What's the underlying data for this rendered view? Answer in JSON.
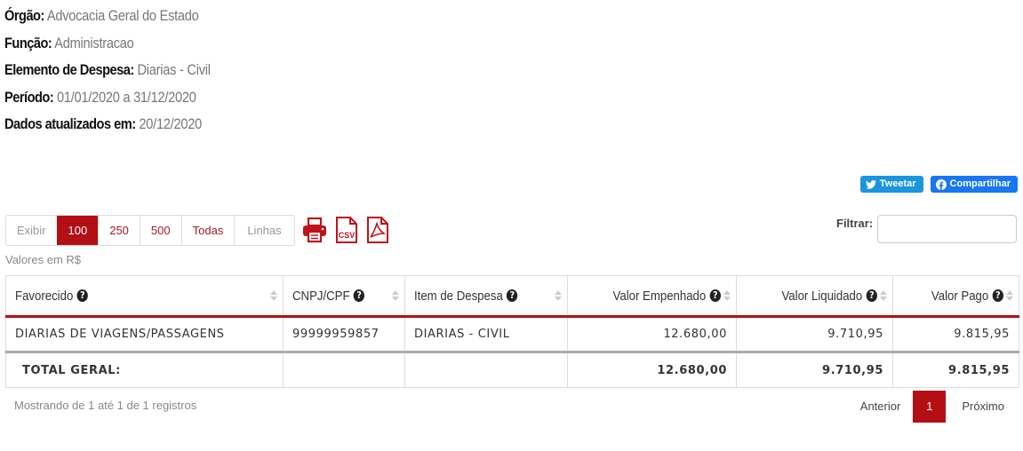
{
  "meta": [
    {
      "label": "Órgão:",
      "value": "Advocacia Geral do Estado"
    },
    {
      "label": "Função:",
      "value": "Administracao"
    },
    {
      "label": "Elemento de Despesa:",
      "value": "Diarias - Civil"
    },
    {
      "label": "Período:",
      "value": "01/01/2020 a 31/12/2020"
    },
    {
      "label": "Dados atualizados em:",
      "value": "20/12/2020"
    }
  ],
  "social": {
    "tweet": "Tweetar",
    "share": "Compartilhar",
    "tweet_color": "#1b95e0",
    "share_color": "#1877f2"
  },
  "page_size": {
    "show_label": "Exibir",
    "options": [
      "100",
      "250",
      "500",
      "Todas"
    ],
    "selected": "100",
    "suffix": "Linhas"
  },
  "exports": {
    "print_icon": "print-icon",
    "csv_label": "CSV",
    "pdf_icon": "pdf-icon"
  },
  "filter": {
    "label": "Filtrar:",
    "value": ""
  },
  "currency_note": "Valores em R$",
  "table": {
    "columns": [
      "Favorecido",
      "CNPJ/CPF",
      "Item de Despesa",
      "Valor Empenhado",
      "Valor Liquidado",
      "Valor Pago"
    ],
    "rows": [
      [
        "DIARIAS DE VIAGENS/PASSAGENS",
        "99999959857",
        "DIARIAS - CIVIL",
        "12.680,00",
        "9.710,95",
        "9.815,95"
      ]
    ],
    "total": {
      "label": "TOTAL GERAL:",
      "empenhado": "12.680,00",
      "liquidado": "9.710,95",
      "pago": "9.815,95"
    }
  },
  "footer": {
    "showing": "Mostrando de 1 até 1 de 1 registros",
    "prev": "Anterior",
    "current_page": "1",
    "next": "Próximo"
  },
  "colors": {
    "accent": "#b30f15"
  }
}
